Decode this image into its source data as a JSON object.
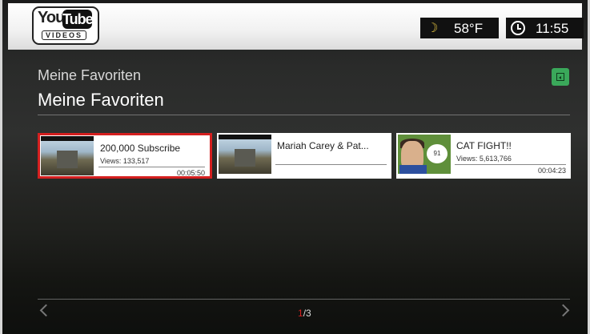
{
  "header": {
    "logo": {
      "you": "You",
      "tube": "Tube",
      "sub": "VIDEOS"
    },
    "weather": {
      "icon": "moon-cloud-icon",
      "temp": "58°F"
    },
    "clock": {
      "icon": "clock-icon",
      "time": "11:55"
    }
  },
  "page": {
    "breadcrumb": "Meine Favoriten",
    "title": "Meine Favoriten"
  },
  "menu_button": {
    "icon": "menu-icon",
    "color": "#3aa85a"
  },
  "videos": [
    {
      "title": "200,000 Subscribe",
      "views": "Views: 133,517",
      "duration": "00:05:50",
      "selected": true,
      "selection_color": "#d41f1f"
    },
    {
      "title": "Mariah Carey & Pat...",
      "views": "",
      "duration": "",
      "selected": false
    },
    {
      "title": "CAT FIGHT!!",
      "views": "Views: 5,613,766",
      "duration": "00:04:23",
      "selected": false
    }
  ],
  "pager": {
    "current": "1",
    "total": "/3"
  }
}
